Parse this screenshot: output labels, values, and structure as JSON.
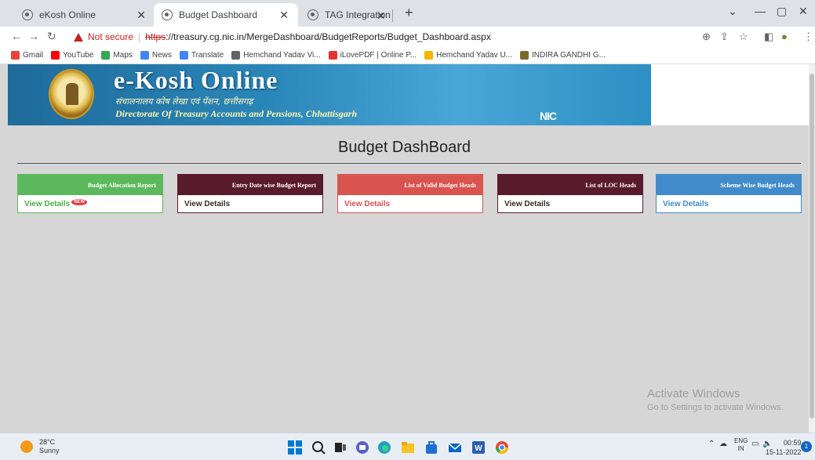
{
  "browser": {
    "tabs": [
      {
        "title": "eKosh Online",
        "active": false
      },
      {
        "title": "Budget Dashboard",
        "active": true
      },
      {
        "title": "TAG Integration",
        "active": false
      }
    ],
    "new_tab": "+",
    "address": {
      "security_label": "Not secure",
      "scheme": "https",
      "rest": "://treasury.cg.nic.in/MergeDashboard/BudgetReports/Budget_Dashboard.aspx"
    },
    "bookmarks": [
      {
        "label": "Gmail",
        "icon": "gmail-icon",
        "color": "#ea4335"
      },
      {
        "label": "YouTube",
        "icon": "youtube-icon",
        "color": "#ff0000"
      },
      {
        "label": "Maps",
        "icon": "maps-icon",
        "color": "#34a853"
      },
      {
        "label": "News",
        "icon": "news-icon",
        "color": "#4285f4"
      },
      {
        "label": "Translate",
        "icon": "translate-icon",
        "color": "#4285f4"
      },
      {
        "label": "Hemchand Yadav Vi...",
        "icon": "globe-icon",
        "color": "#5f6368"
      },
      {
        "label": "iLovePDF | Online P...",
        "icon": "heart-icon",
        "color": "#e5322d"
      },
      {
        "label": "Hemchand Yadav U...",
        "icon": "pencil-icon",
        "color": "#f4b400"
      },
      {
        "label": "INDIRA GANDHI G...",
        "icon": "emblem-icon",
        "color": "#7a6a2a"
      }
    ]
  },
  "header": {
    "brand_title": "e-Kosh Online",
    "brand_hindi": "संचालनालय कोष लेखा एवं पेंशन, छत्तीसगढ़",
    "brand_subtitle": "Directorate Of Treasury Accounts and Pensions, Chhattisgarh",
    "nic": "NIC"
  },
  "dashboard": {
    "title": "Budget DashBoard",
    "cards": [
      {
        "title": "Budget Allocation Report",
        "link": "View Details",
        "badge": "NEW",
        "head_color": "#5cb85c",
        "link_color": "#4cae4c"
      },
      {
        "title": "Entry Date wise Budget Report",
        "link": "View Details",
        "badge": "",
        "head_color": "#5a1a2e",
        "link_color": "#3a2a2a"
      },
      {
        "title": "List of Valid Budget Heads",
        "link": "View Details",
        "badge": "",
        "head_color": "#d9534f",
        "link_color": "#d9534f"
      },
      {
        "title": "List of LOC Heads",
        "link": "View Details",
        "badge": "",
        "head_color": "#5a1a2e",
        "link_color": "#3a2a2a"
      },
      {
        "title": "Scheme Wise Budget Heads",
        "link": "View Details",
        "badge": "",
        "head_color": "#428bca",
        "link_color": "#428bca"
      }
    ]
  },
  "watermark": {
    "line1": "Activate Windows",
    "line2": "Go to Settings to activate Windows."
  },
  "taskbar": {
    "temperature": "28°C",
    "condition": "Sunny",
    "lang1": "ENG",
    "lang2": "IN",
    "time": "00:59",
    "date": "15-11-2022",
    "notifications": "1"
  }
}
